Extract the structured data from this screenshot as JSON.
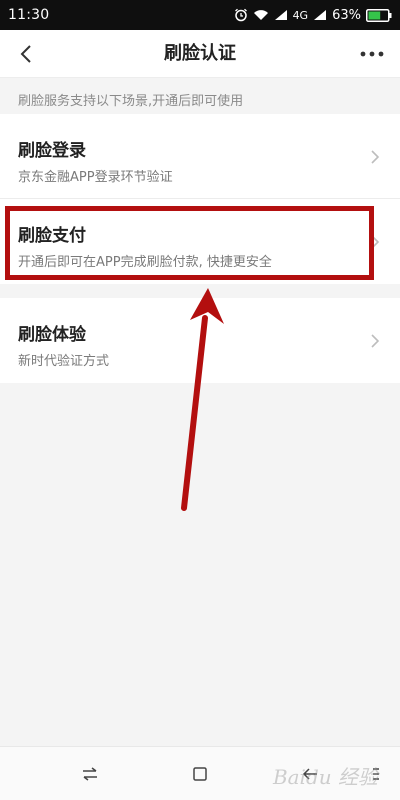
{
  "status_bar": {
    "time": "11:30",
    "network": "4G",
    "battery_percent": "63%",
    "battery_level": 0.63,
    "battery_color": "#35c44a",
    "icons": [
      "alarm-icon",
      "wifi-icon",
      "signal-icon",
      "signal-icon",
      "battery-icon"
    ]
  },
  "header": {
    "title": "刷脸认证",
    "back_icon": "back-icon",
    "more_icon": "more-icon"
  },
  "section_label": "刷脸服务支持以下场景,开通后即可使用",
  "rows": [
    {
      "title": "刷脸登录",
      "desc": "京东金融APP登录环节验证"
    },
    {
      "title": "刷脸支付",
      "desc": "开通后即可在APP完成刷脸付款, 快捷更安全"
    },
    {
      "title": "刷脸体验",
      "desc": "新时代验证方式"
    }
  ],
  "annotation": {
    "highlight_color": "#b30f0f",
    "target_row": "刷脸支付"
  },
  "bottom_nav": {
    "icons": [
      "switch-icon",
      "home-square-icon",
      "back-arrow-icon",
      "menu-icon"
    ]
  },
  "watermark": "Baidu 经验"
}
